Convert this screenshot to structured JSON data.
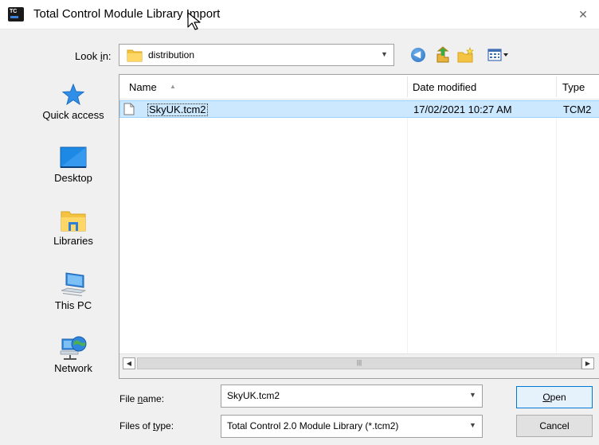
{
  "window": {
    "title": "Total Control Module Library Import",
    "close_glyph": "✕",
    "app_icon_text": "TC"
  },
  "look_in": {
    "label_pre": "Look ",
    "label_key": "i",
    "label_post": "n:",
    "value": "distribution"
  },
  "places": [
    {
      "label": "Quick access",
      "icon": "star-icon"
    },
    {
      "label": "Desktop",
      "icon": "desktop-icon"
    },
    {
      "label": "Libraries",
      "icon": "libraries-icon"
    },
    {
      "label": "This PC",
      "icon": "computer-icon"
    },
    {
      "label": "Network",
      "icon": "network-icon"
    }
  ],
  "columns": {
    "name": "Name",
    "date_modified": "Date modified",
    "type": "Type"
  },
  "files": [
    {
      "name": "SkyUK.tcm2",
      "date_modified": "17/02/2021 10:27 AM",
      "type": "TCM2"
    }
  ],
  "file_name": {
    "label_pre": "File ",
    "label_key": "n",
    "label_post": "ame:",
    "value": "SkyUK.tcm2"
  },
  "file_type": {
    "label_pre": "Files of ",
    "label_key": "t",
    "label_post": "ype:",
    "value": "Total Control 2.0 Module Library (*.tcm2)"
  },
  "buttons": {
    "open_key": "O",
    "open_rest": "pen",
    "cancel": "Cancel"
  },
  "scrollbar": {
    "left_glyph": "◀",
    "right_glyph": "▶",
    "thumb_glyph": "|||"
  },
  "colors": {
    "selection_bg": "#cce8ff",
    "selection_border": "#99d1ff",
    "default_button_border": "#0078d7"
  }
}
